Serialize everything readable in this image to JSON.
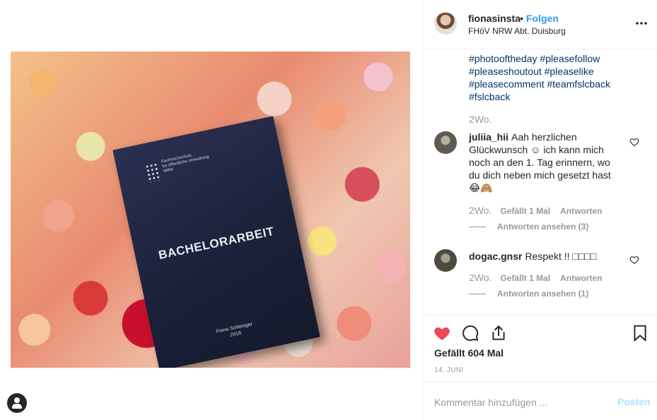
{
  "post": {
    "book": {
      "org_line1": "Fachhochschule",
      "org_line2": "für öffentliche Verwaltung",
      "org_line3": "NRW",
      "title": "BACHELORARBEIT",
      "author": "Fiona Schlesiger",
      "year": "2018"
    }
  },
  "header": {
    "username": "fionasinsta",
    "separator": "•",
    "follow_label": "Folgen",
    "location": "FHöV NRW Abt. Duisburg"
  },
  "caption": {
    "hashtags": [
      "#photooftheday #pleasefollow",
      "#pleaseshoutout #pleaselike",
      "#pleasecomment #teamfslcback",
      "#fslcback"
    ],
    "time": "2Wo."
  },
  "comments": [
    {
      "username": "juliia_hii",
      "text": "Aah herzlichen Glückwunsch ☺ ich kann mich noch an den 1. Tag erinnern, wo du dich neben mich gesetzt hast 😂🙈",
      "time": "2Wo.",
      "likes": "Gefällt 1 Mal",
      "reply_label": "Antworten",
      "view_replies": "Antworten ansehen (3)"
    },
    {
      "username": "dogac.gnsr",
      "text": "Respekt !! □□□□",
      "time": "2Wo.",
      "likes": "Gefällt 1 Mal",
      "reply_label": "Antworten",
      "view_replies": "Antworten ansehen (1)"
    }
  ],
  "actions": {
    "likes_text": "Gefällt 604 Mal",
    "date": "14. JUNI",
    "like_color": "#ed4956"
  },
  "add_comment": {
    "placeholder": "Kommentar hinzufügen ...",
    "post_label": "Posten"
  },
  "colors": {
    "link": "#3897f0",
    "hashtag": "#003569",
    "muted": "#999999"
  }
}
